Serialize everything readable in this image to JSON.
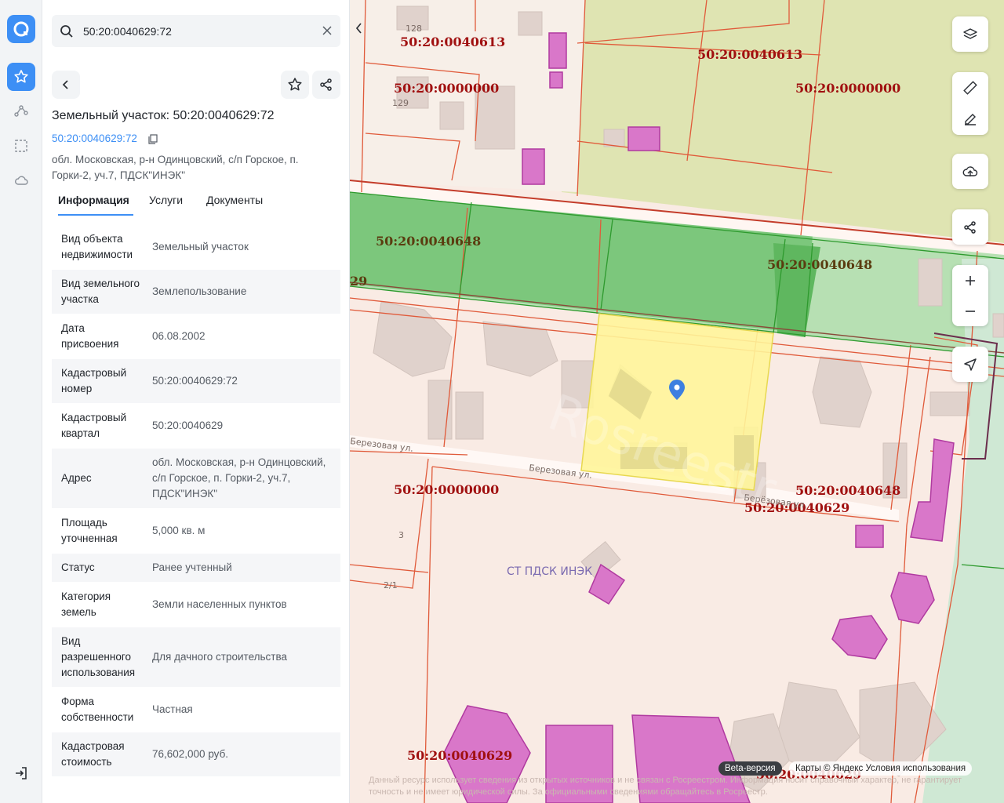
{
  "search": {
    "value": "50:20:0040629:72"
  },
  "parcel": {
    "title": "Земельный участок: 50:20:0040629:72",
    "cadastral_link": "50:20:0040629:72",
    "address": "обл. Московская, р-н Одинцовский, с/п Горское, п. Горки-2, уч.7, ПДСК\"ИНЭК\""
  },
  "tabs": [
    {
      "label": "Информация",
      "active": true
    },
    {
      "label": "Услуги",
      "active": false
    },
    {
      "label": "Документы",
      "active": false
    }
  ],
  "info_rows": [
    {
      "key": "Вид объекта недвижимости",
      "value": "Земельный участок"
    },
    {
      "key": "Вид земельного участка",
      "value": "Землепользование"
    },
    {
      "key": "Дата присвоения",
      "value": "06.08.2002"
    },
    {
      "key": "Кадастровый номер",
      "value": "50:20:0040629:72"
    },
    {
      "key": "Кадастровый квартал",
      "value": "50:20:0040629"
    },
    {
      "key": "Адрес",
      "value": "обл. Московская, р-н Одинцовский, с/п Горское, п. Горки-2, уч.7, ПДСК\"ИНЭК\""
    },
    {
      "key": "Площадь уточненная",
      "value": "5,000 кв. м"
    },
    {
      "key": "Статус",
      "value": "Ранее учтенный"
    },
    {
      "key": "Категория земель",
      "value": "Земли населенных пунктов"
    },
    {
      "key": "Вид разрешенного использования",
      "value": "Для дачного строительства"
    },
    {
      "key": "Форма собственности",
      "value": "Частная"
    },
    {
      "key": "Кадастровая стоимость",
      "value": "76,602,000 руб."
    }
  ],
  "map": {
    "labels": {
      "q0040613_a": "50:20:0040613",
      "q0040613_b": "50:20:0040613",
      "q0000000_a": "50:20:0000000",
      "q0000000_b": "50:20:0000000",
      "q0000000_c": "50:20:0000000",
      "q0040648_a": "50:20:0040648",
      "q0040648_b": "50:20:0040648",
      "q0040648_c": "50:20:0040648",
      "q0040629_a": "50:20:0040629",
      "q0040629_b": "50:20:0040629",
      "q0040629_c": "50:20:0040629",
      "edge29": "29",
      "house128": "128",
      "house129": "129",
      "house3": "3",
      "house21": "2/1",
      "street_a": "Березовая ул.",
      "street_b": "Берёзовая ул.",
      "street_c": "Березовая ул.",
      "snt": "СТ ПДСК ИНЭК",
      "watermark": "Rosreestr"
    },
    "beta_label": "Beta-версия",
    "attribution": "Карты © Яндекс  Условия использования",
    "disclaimer": "Данный ресурс использует сведения из открытых источников и не связан с Росреестром. Информация носит справочный характер, не гарантирует точность и не имеет юридической силы. За официальными сведениями обращайтесь в Росреестр."
  },
  "colors": {
    "accent": "#3d8ff5",
    "parcel_border": "#e05a3a",
    "selected_fill": "#fff59a",
    "forest_fill": "#7fc97f",
    "building_fill": "#d977c9",
    "label_red": "#a01010"
  }
}
